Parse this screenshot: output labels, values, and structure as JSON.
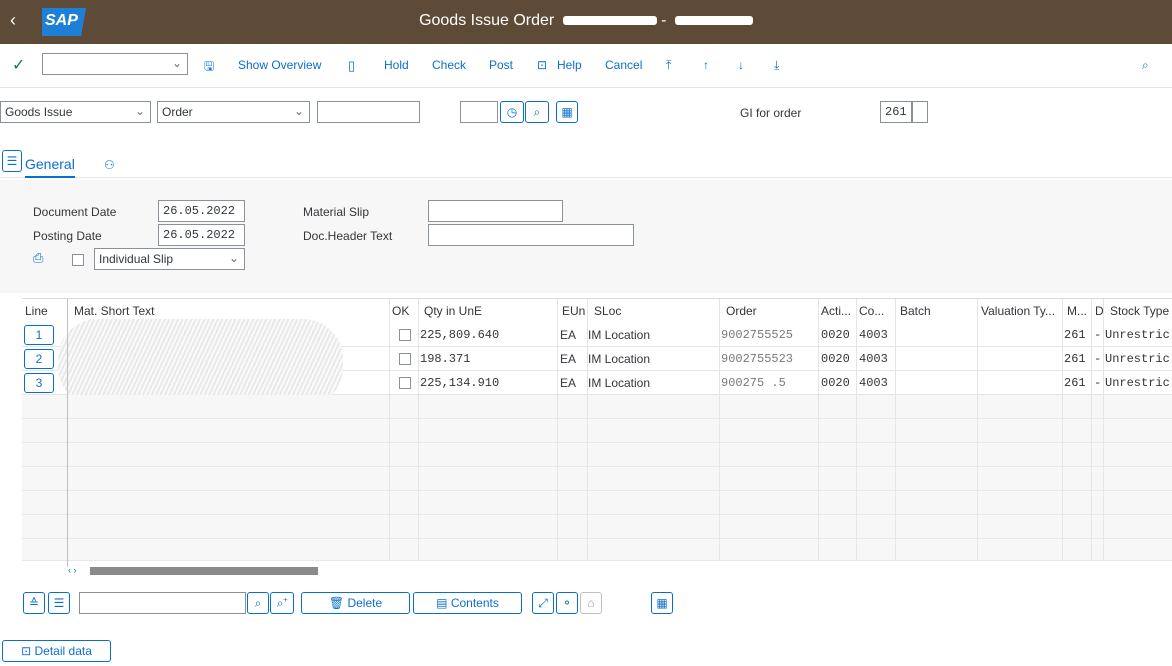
{
  "titlebar": {
    "back": "‹",
    "logo": "SAP",
    "title": "Goods Issue Order",
    "suffix": "- "
  },
  "toolbar": {
    "check_icon": "check-icon",
    "show_overview": "Show Overview",
    "hold": "Hold",
    "check": "Check",
    "post": "Post",
    "help": "Help",
    "cancel": "Cancel"
  },
  "header": {
    "action": "Goods Issue",
    "ref_doc": "Order",
    "gi_label": "GI for order",
    "movement_type": "261"
  },
  "tabs": {
    "general": "General"
  },
  "form": {
    "doc_date_label": "Document Date",
    "doc_date": "26.05.2022",
    "posting_date_label": "Posting Date",
    "posting_date": "26.05.2022",
    "material_slip_label": "Material Slip",
    "doc_header_label": "Doc.Header Text",
    "slip_type": "Individual Slip"
  },
  "grid": {
    "columns": [
      "Line",
      "Mat. Short Text",
      "OK",
      "Qty in UnE",
      "EUn",
      "SLoc",
      "Order",
      "Acti...",
      "Co...",
      "Batch",
      "Valuation Ty...",
      "M...",
      "D",
      "Stock Type"
    ],
    "rows": [
      {
        "line": "1",
        "qty": "225,809.640",
        "eun": "EA",
        "sloc": "IM Location",
        "order": "9002755525",
        "acti": "0020",
        "co": "4003",
        "m": "261",
        "d": "-",
        "stock": "Unrestric"
      },
      {
        "line": "2",
        "qty": "198.371",
        "eun": "EA",
        "sloc": "IM Location",
        "order": "9002755523",
        "acti": "0020",
        "co": "4003",
        "m": "261",
        "d": "-",
        "stock": "Unrestric"
      },
      {
        "line": "3",
        "qty": "225,134.910",
        "eun": "EA",
        "sloc": "IM Location",
        "order": "900275 .5",
        "acti": "0020",
        "co": "4003",
        "m": "261",
        "d": "-",
        "stock": "Unrestric"
      }
    ]
  },
  "bottom": {
    "delete": "Delete",
    "contents": "Contents",
    "detail_data": "Detail data",
    "scroll_arrows": "‹ ›"
  }
}
